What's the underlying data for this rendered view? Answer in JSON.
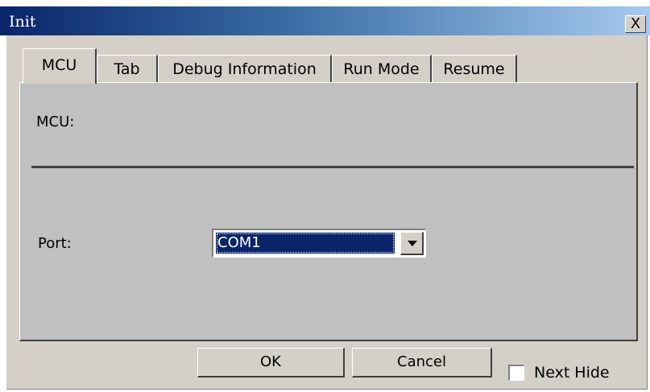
{
  "window": {
    "title": "Init",
    "close_symbol": "X"
  },
  "tabs": [
    {
      "label": "MCU",
      "active": true
    },
    {
      "label": "Tab",
      "active": false
    },
    {
      "label": "Debug Information",
      "active": false
    },
    {
      "label": "Run Mode",
      "active": false
    },
    {
      "label": "Resume",
      "active": false
    }
  ],
  "panel": {
    "mcu_label": "MCU:",
    "port_label": "Port:",
    "port_value": "COM1"
  },
  "buttons": {
    "ok": "OK",
    "cancel": "Cancel"
  },
  "next_hide": {
    "label": "Next Hide",
    "checked": false
  }
}
